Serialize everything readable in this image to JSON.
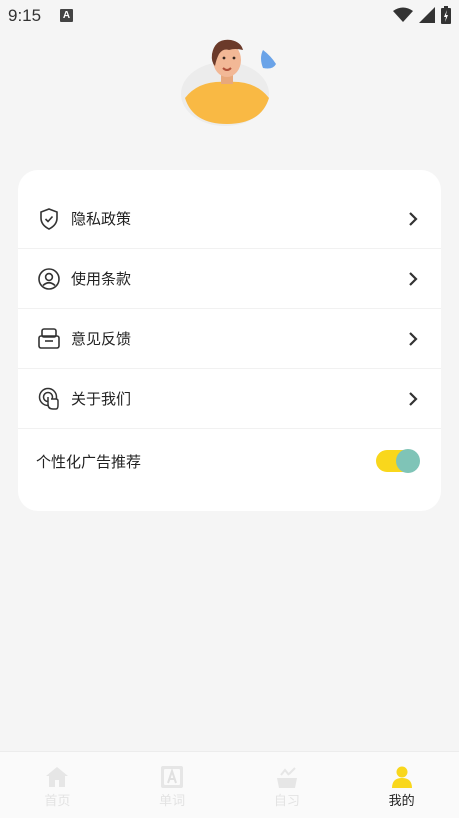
{
  "status": {
    "time": "9:15",
    "badge": "A"
  },
  "menu": [
    {
      "label": "隐私政策",
      "icon": "shield-icon"
    },
    {
      "label": "使用条款",
      "icon": "user-circle-icon"
    },
    {
      "label": "意见反馈",
      "icon": "feedback-icon"
    },
    {
      "label": "关于我们",
      "icon": "about-icon"
    }
  ],
  "toggle": {
    "label": "个性化广告推荐",
    "on": true
  },
  "nav": [
    {
      "label": "首页",
      "icon": "home-icon",
      "active": false
    },
    {
      "label": "单词",
      "icon": "word-icon",
      "active": false
    },
    {
      "label": "自习",
      "icon": "study-icon",
      "active": false
    },
    {
      "label": "我的",
      "icon": "profile-icon",
      "active": true
    }
  ],
  "colors": {
    "accent": "#f9d71c",
    "toggle_knob": "#7fc4b7",
    "card": "#ffffff",
    "background": "#f5f5f5"
  }
}
